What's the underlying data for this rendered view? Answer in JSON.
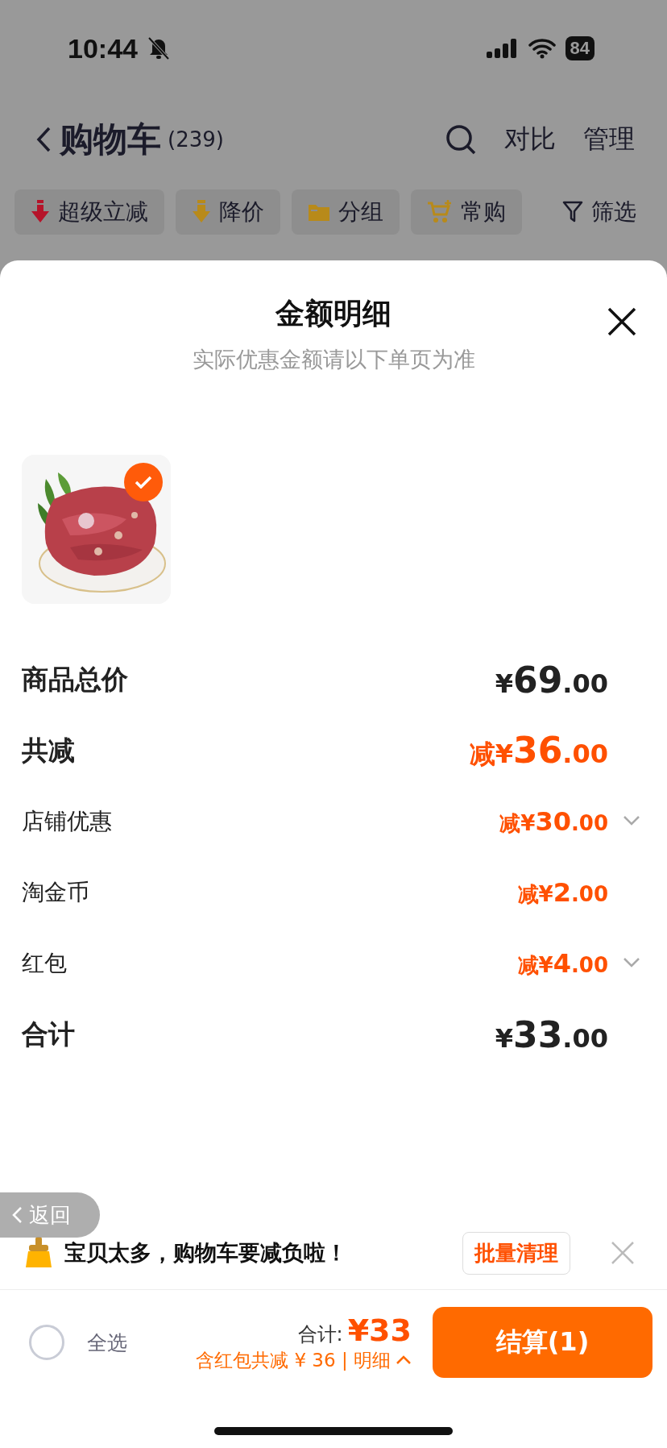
{
  "status_bar": {
    "time": "10:44",
    "battery": "84"
  },
  "nav": {
    "title": "购物车",
    "count": "(239)",
    "actions": [
      "对比",
      "管理"
    ]
  },
  "filters": [
    {
      "label": "超级立减",
      "kind": "bolt"
    },
    {
      "label": "降价",
      "kind": "down"
    },
    {
      "label": "分组",
      "kind": "folder"
    },
    {
      "label": "常购",
      "kind": "cart"
    },
    {
      "label": "筛选",
      "kind": "filter"
    }
  ],
  "sheet": {
    "title": "金额明细",
    "subtitle": "实际优惠金额请以下单页为准",
    "items": [
      {
        "kind": "picture",
        "selected": true
      }
    ],
    "rows": [
      {
        "label": "商品总价",
        "amount": "¥69.00",
        "kind": "major",
        "discount": false,
        "expandable": false
      },
      {
        "label": "共减",
        "amount": "减¥36.00",
        "kind": "major",
        "discount": true,
        "expandable": false
      },
      {
        "label": "店铺优惠",
        "amount": "减¥30.00",
        "kind": "minor",
        "discount": true,
        "expandable": true
      },
      {
        "label": "淘金币",
        "amount": "减¥2.00",
        "kind": "minor",
        "discount": true,
        "expandable": false
      },
      {
        "label": "红包",
        "amount": "减¥4.00",
        "kind": "minor",
        "discount": true,
        "expandable": true
      },
      {
        "label": "合计",
        "amount": "¥33.00",
        "kind": "major",
        "discount": false,
        "expandable": false
      }
    ]
  },
  "back_pill": "返回",
  "notice": {
    "text": "宝贝太多，购物车要减负啦！",
    "button": "批量清理"
  },
  "footer": {
    "select_all": {
      "label": "全选",
      "checked": false
    },
    "total_label": "合计:",
    "total": "¥33",
    "detail": "含红包共减 ¥ 36 | 明细",
    "checkout": "结算(1)"
  }
}
